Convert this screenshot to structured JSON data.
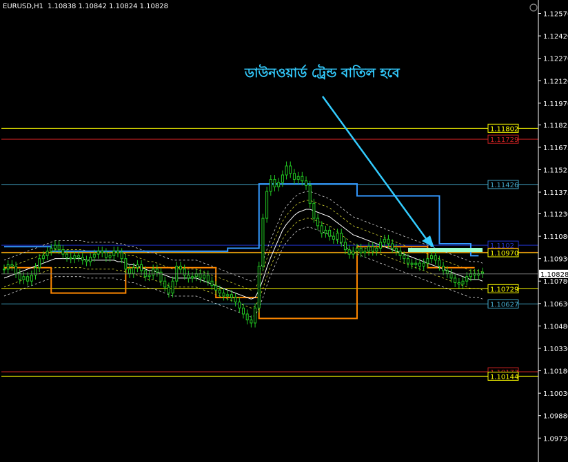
{
  "header": {
    "symbol_timeframe": "EURUSD,H1",
    "ohlc": "1.10838 1.10842 1.10824 1.10828"
  },
  "annotation": {
    "text": "ডাউনওয়ার্ড ট্রেন্ড বাতিল হবে",
    "color": "#33ccff"
  },
  "colors": {
    "background": "#000000",
    "axis": "#ffffff",
    "candle": "#22cc22",
    "ma_cyan": "#3399ff",
    "ma_orange": "#ff8800",
    "ma_white": "#ffffff",
    "bands_white": "#dddddd",
    "bands_yellow": "#dddd33",
    "level_yellow": "#ffff00",
    "level_red": "#cc2222",
    "level_cyan": "#44aacc",
    "level_blue": "#2233cc"
  },
  "chart_data": {
    "type": "line",
    "title": "EURUSD,H1",
    "ylim": [
      1.0957,
      1.1266
    ],
    "y_ticks": [
      "1.12570",
      "1.12420",
      "1.12270",
      "1.12120",
      "1.11970",
      "1.11825",
      "1.11675",
      "1.11525",
      "1.11375",
      "1.11230",
      "1.11080",
      "1.10930",
      "1.10780",
      "1.10630",
      "1.10480",
      "1.10330",
      "1.10180",
      "1.10030",
      "1.09880",
      "1.09730"
    ],
    "y_tick_values": [
      1.1257,
      1.1242,
      1.1227,
      1.1212,
      1.1197,
      1.11825,
      1.11675,
      1.11525,
      1.11375,
      1.1123,
      1.1108,
      1.1093,
      1.1078,
      1.1063,
      1.1048,
      1.1033,
      1.1018,
      1.1003,
      1.0988,
      1.0973
    ],
    "current_price": "1.10828",
    "levels": [
      {
        "value": 1.11802,
        "label": "1.11802",
        "color": "#ffff00"
      },
      {
        "value": 1.11729,
        "label": "1.11729",
        "color": "#cc2222"
      },
      {
        "value": 1.11426,
        "label": "1.11426",
        "color": "#44aacc"
      },
      {
        "value": 1.1102,
        "label": "1.1102",
        "color": "#2233cc"
      },
      {
        "value": 1.10973,
        "label": "1.10973",
        "color": "#cc2222"
      },
      {
        "value": 1.1097,
        "label": "1.10970",
        "color": "#ffff00"
      },
      {
        "value": 1.10729,
        "label": "1.10729",
        "color": "#ffff00"
      },
      {
        "value": 1.10627,
        "label": "1.10627",
        "color": "#44aacc"
      },
      {
        "value": 1.10173,
        "label": "1.10173",
        "color": "#cc2222"
      },
      {
        "value": 1.10144,
        "label": "1.10144",
        "color": "#ffff00"
      }
    ],
    "candles_close": [
      1.1086,
      1.1089,
      1.1088,
      1.1083,
      1.1079,
      1.1081,
      1.1078,
      1.1082,
      1.1087,
      1.1093,
      1.1095,
      1.1098,
      1.11,
      1.1102,
      1.1099,
      1.1096,
      1.1094,
      1.1093,
      1.1095,
      1.1094,
      1.1092,
      1.1091,
      1.1094,
      1.1096,
      1.1098,
      1.1097,
      1.1094,
      1.1095,
      1.1098,
      1.1097,
      1.1093,
      1.1086,
      1.1083,
      1.1087,
      1.1089,
      1.1085,
      1.1081,
      1.1082,
      1.1086,
      1.1084,
      1.1078,
      1.1074,
      1.107,
      1.1078,
      1.1088,
      1.1086,
      1.1082,
      1.108,
      1.1081,
      1.1083,
      1.108,
      1.1082,
      1.1078,
      1.1075,
      1.1072,
      1.107,
      1.1068,
      1.1069,
      1.1067,
      1.1064,
      1.106,
      1.1056,
      1.1052,
      1.105,
      1.106,
      1.1088,
      1.112,
      1.1138,
      1.1146,
      1.1141,
      1.1144,
      1.1149,
      1.1155,
      1.115,
      1.1146,
      1.1148,
      1.1145,
      1.1142,
      1.113,
      1.112,
      1.1115,
      1.111,
      1.1112,
      1.1108,
      1.1106,
      1.111,
      1.1104,
      1.1099,
      1.1096,
      1.1098,
      1.11,
      1.1097,
      1.1098,
      1.1101,
      1.1098,
      1.11,
      1.1104,
      1.1106,
      1.1103,
      1.11,
      1.1098,
      1.1095,
      1.1093,
      1.109,
      1.1089,
      1.109,
      1.1088,
      1.109,
      1.1093,
      1.1095,
      1.1092,
      1.1088,
      1.1085,
      1.1083,
      1.108,
      1.1077,
      1.1076,
      1.1078,
      1.1081,
      1.1083,
      1.1082,
      1.1083,
      1.1084
    ],
    "series": [
      {
        "name": "",
        "color": "#3399ff",
        "style": "step",
        "values": [
          1.1101,
          1.1101,
          1.1101,
          1.1101,
          1.1101,
          1.1101,
          1.1101,
          1.1101,
          1.1101,
          1.1101,
          1.1101,
          1.1101,
          1.1098,
          1.1098,
          1.1098,
          1.1098,
          1.1098,
          1.1098,
          1.1098,
          1.1098,
          1.1098,
          1.1098,
          1.1098,
          1.1098,
          1.1098,
          1.1098,
          1.1098,
          1.1098,
          1.1098,
          1.1098,
          1.1098,
          1.1098,
          1.1098,
          1.1098,
          1.1098,
          1.1098,
          1.1098,
          1.1098,
          1.1098,
          1.1098,
          1.1098,
          1.1098,
          1.1098,
          1.1098,
          1.1098,
          1.1098,
          1.1098,
          1.1098,
          1.1098,
          1.1098,
          1.1098,
          1.1098,
          1.1098,
          1.1098,
          1.1098,
          1.1098,
          1.1098,
          1.11,
          1.11,
          1.11,
          1.11,
          1.11,
          1.11,
          1.11,
          1.11,
          1.1143,
          1.1143,
          1.1143,
          1.1143,
          1.1143,
          1.1143,
          1.1143,
          1.1143,
          1.1143,
          1.1143,
          1.1143,
          1.1143,
          1.1143,
          1.1143,
          1.1143,
          1.1143,
          1.1143,
          1.1143,
          1.1143,
          1.1143,
          1.1143,
          1.1143,
          1.1143,
          1.1143,
          1.1143,
          1.1135,
          1.1135,
          1.1135,
          1.1135,
          1.1135,
          1.1135,
          1.1135,
          1.1135,
          1.1135,
          1.1135,
          1.1135,
          1.1135,
          1.1135,
          1.1135,
          1.1135,
          1.1135,
          1.1135,
          1.1135,
          1.1135,
          1.1135,
          1.1135,
          1.1103,
          1.1103,
          1.1103,
          1.1103,
          1.1103,
          1.1103,
          1.1103,
          1.1103,
          1.1095,
          1.1095,
          1.1095
        ]
      },
      {
        "name": "",
        "color": "#ff8800",
        "style": "step",
        "values": [
          1.1087,
          1.1087,
          1.1087,
          1.1087,
          1.1087,
          1.1087,
          1.1087,
          1.1087,
          1.1087,
          1.1087,
          1.1087,
          1.1087,
          1.107,
          1.107,
          1.107,
          1.107,
          1.107,
          1.107,
          1.107,
          1.107,
          1.107,
          1.107,
          1.107,
          1.107,
          1.107,
          1.107,
          1.107,
          1.107,
          1.107,
          1.107,
          1.107,
          1.1087,
          1.1087,
          1.1087,
          1.1087,
          1.1087,
          1.1087,
          1.1087,
          1.1087,
          1.1087,
          1.1087,
          1.1087,
          1.1087,
          1.1087,
          1.1087,
          1.1087,
          1.1087,
          1.1087,
          1.1087,
          1.1087,
          1.1087,
          1.1087,
          1.1087,
          1.1087,
          1.1067,
          1.1067,
          1.1067,
          1.1067,
          1.1067,
          1.1067,
          1.1067,
          1.1067,
          1.1067,
          1.1067,
          1.1067,
          1.1053,
          1.1053,
          1.1053,
          1.1053,
          1.1053,
          1.1053,
          1.1053,
          1.1053,
          1.1053,
          1.1053,
          1.1053,
          1.1053,
          1.1053,
          1.1053,
          1.1053,
          1.1053,
          1.1053,
          1.1053,
          1.1053,
          1.1053,
          1.1053,
          1.1053,
          1.1053,
          1.1053,
          1.1053,
          1.1101,
          1.1101,
          1.1101,
          1.1101,
          1.1101,
          1.1101,
          1.1101,
          1.1101,
          1.1101,
          1.1101,
          1.1101,
          1.1101,
          1.1101,
          1.1101,
          1.1101,
          1.1101,
          1.1101,
          1.1101,
          1.1087,
          1.1087,
          1.1087,
          1.1087,
          1.1087,
          1.1087,
          1.1087,
          1.1087,
          1.1087,
          1.1087,
          1.1087,
          1.1087,
          1.1087
        ]
      },
      {
        "name": "",
        "color": "#ffffff",
        "style": "line",
        "values": [
          1.108,
          1.1081,
          1.1082,
          1.1083,
          1.1084,
          1.1085,
          1.1086,
          1.1087,
          1.1088,
          1.1089,
          1.109,
          1.1091,
          1.1092,
          1.1093,
          1.1093,
          1.1093,
          1.1093,
          1.1093,
          1.1093,
          1.1093,
          1.1093,
          1.1092,
          1.1092,
          1.1092,
          1.1092,
          1.1092,
          1.1092,
          1.1092,
          1.1092,
          1.1091,
          1.1091,
          1.109,
          1.1089,
          1.1089,
          1.1088,
          1.1087,
          1.1086,
          1.1085,
          1.1085,
          1.1084,
          1.1083,
          1.1082,
          1.1081,
          1.108,
          1.108,
          1.108,
          1.108,
          1.108,
          1.108,
          1.108,
          1.1079,
          1.1078,
          1.1077,
          1.1076,
          1.1075,
          1.1074,
          1.1073,
          1.1072,
          1.1071,
          1.107,
          1.1069,
          1.1068,
          1.1067,
          1.1066,
          1.1067,
          1.1072,
          1.1079,
          1.1087,
          1.1094,
          1.11,
          1.1106,
          1.1112,
          1.1116,
          1.1119,
          1.1122,
          1.1124,
          1.1125,
          1.1126,
          1.1126,
          1.1125,
          1.1124,
          1.1123,
          1.1122,
          1.1121,
          1.1119,
          1.1117,
          1.1115,
          1.1113,
          1.1111,
          1.1109,
          1.1108,
          1.1107,
          1.1106,
          1.1105,
          1.1104,
          1.1103,
          1.1102,
          1.1101,
          1.11,
          1.1099,
          1.1098,
          1.1097,
          1.1096,
          1.1095,
          1.1094,
          1.1093,
          1.1092,
          1.1091,
          1.109,
          1.1089,
          1.1088,
          1.1087,
          1.1086,
          1.1085,
          1.1084,
          1.1083,
          1.1082,
          1.1081,
          1.108,
          1.1079,
          1.1079,
          1.1079,
          1.1078
        ]
      }
    ]
  }
}
